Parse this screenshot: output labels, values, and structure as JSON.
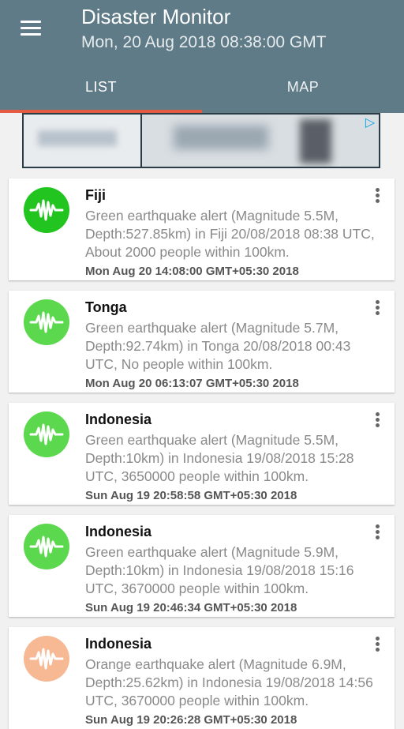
{
  "header": {
    "title": "Disaster Monitor",
    "subtitle": "Mon, 20 Aug 2018 08:38:00 GMT"
  },
  "tabs": [
    {
      "label": "LIST",
      "selected": true
    },
    {
      "label": "MAP",
      "selected": false
    }
  ],
  "colors": {
    "appbar": "#5f7b87",
    "tab_indicator": "#e45a43",
    "green_alert": "#2ecc40",
    "light_green_alert": "#6ad85a",
    "orange_alert": "#f7b894"
  },
  "alerts": [
    {
      "place": "Fiji",
      "description": "Green earthquake alert (Magnitude 5.5M, Depth:527.85km) in Fiji 20/08/2018 08:38 UTC, About 2000 people within 100km.",
      "time": "Mon Aug 20 14:08:00 GMT+05:30 2018",
      "level": "green",
      "icon": "earthquake-waveform-icon"
    },
    {
      "place": "Tonga",
      "description": "Green earthquake alert (Magnitude 5.7M, Depth:92.74km) in Tonga 20/08/2018 00:43 UTC, No people within 100km.",
      "time": "Mon Aug 20 06:13:07 GMT+05:30 2018",
      "level": "green",
      "icon": "earthquake-waveform-icon"
    },
    {
      "place": "Indonesia",
      "description": "Green earthquake alert (Magnitude 5.5M, Depth:10km) in Indonesia 19/08/2018 15:28 UTC, 3650000 people within 100km.",
      "time": "Sun Aug 19 20:58:58 GMT+05:30 2018",
      "level": "green",
      "icon": "earthquake-waveform-icon"
    },
    {
      "place": "Indonesia",
      "description": "Green earthquake alert (Magnitude 5.9M, Depth:10km) in Indonesia 19/08/2018 15:16 UTC, 3670000 people within 100km.",
      "time": "Sun Aug 19 20:46:34 GMT+05:30 2018",
      "level": "green",
      "icon": "earthquake-waveform-icon"
    },
    {
      "place": "Indonesia",
      "description": "Orange earthquake alert (Magnitude 6.9M, Depth:25.62km) in Indonesia 19/08/2018 14:56 UTC, 3670000 people within 100km.",
      "time": "Sun Aug 19 20:26:28 GMT+05:30 2018",
      "level": "orange",
      "icon": "earthquake-waveform-icon"
    }
  ]
}
